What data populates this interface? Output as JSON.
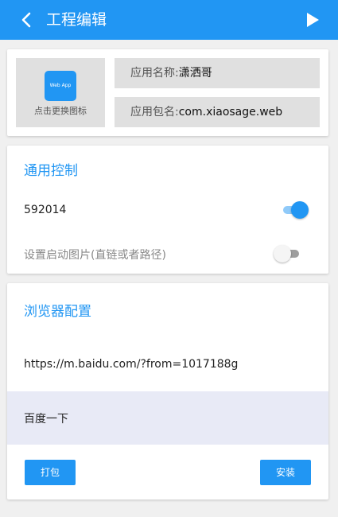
{
  "appbar": {
    "title": "工程编辑",
    "back_icon": "chevron-left-icon",
    "run_icon": "play-icon",
    "color": "#2196f3"
  },
  "app_info": {
    "icon_text": "Web App",
    "change_icon_label": "点击更换图标",
    "name_label": "应用名称:",
    "name_value": "潇洒哥",
    "package_label": "应用包名:",
    "package_value": "com.xiaosage.web"
  },
  "general": {
    "title": "通用控制",
    "switch_1_label": "592014",
    "switch_1_on": true,
    "switch_2_label": "设置启动图片(直链或者路径)",
    "switch_2_on": false
  },
  "browser": {
    "title": "浏览器配置",
    "url": "https://m.baidu.com/?from=1017188g",
    "search_row_label": "百度一下",
    "pack_button": "打包",
    "install_button": "安装"
  }
}
